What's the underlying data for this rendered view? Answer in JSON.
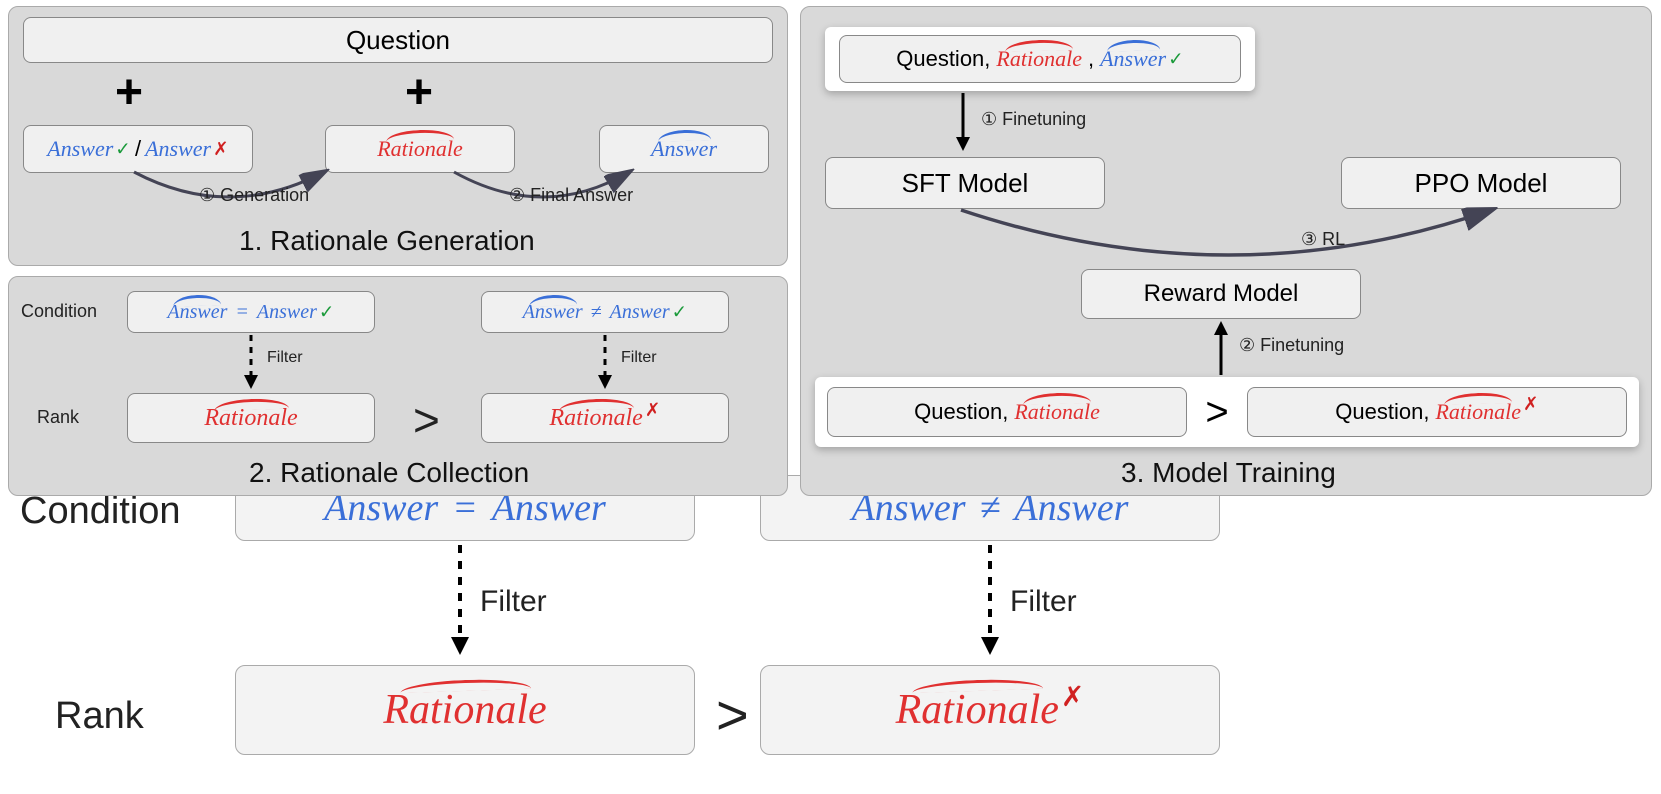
{
  "panel1": {
    "title": "1. Rationale Generation",
    "question": "Question",
    "answer_correct": "Answer",
    "answer_wrong": "Answer",
    "rationale_tilde": "Rationale",
    "answer_tilde": "Answer",
    "step1": "① Generation",
    "step2": "② Final Answer"
  },
  "panel2": {
    "title": "2. Rationale Collection",
    "condition_label": "Condition",
    "rank_label": "Rank",
    "cond_eq_left": "Answer",
    "cond_eq_right": "Answer",
    "cond_ne_left": "Answer",
    "cond_ne_right": "Answer",
    "filter": "Filter",
    "rationale_good": "Rationale",
    "rationale_bad": "Rationale"
  },
  "panel3": {
    "title": "3. Model Training",
    "input_q": "Question",
    "input_r": "Rationale",
    "input_a": "Answer",
    "sft": "SFT Model",
    "ppo": "PPO Model",
    "reward": "Reward Model",
    "step1": "① Finetuning",
    "step2": "② Finetuning",
    "step3": "③ RL",
    "pair_q1": "Question",
    "pair_r1": "Rationale",
    "pair_q2": "Question",
    "pair_r2": "Rationale"
  },
  "bg": {
    "condition": "Condition",
    "rank": "Rank",
    "filter": "Filter",
    "answer": "Answer",
    "rationale": "Rationale"
  }
}
